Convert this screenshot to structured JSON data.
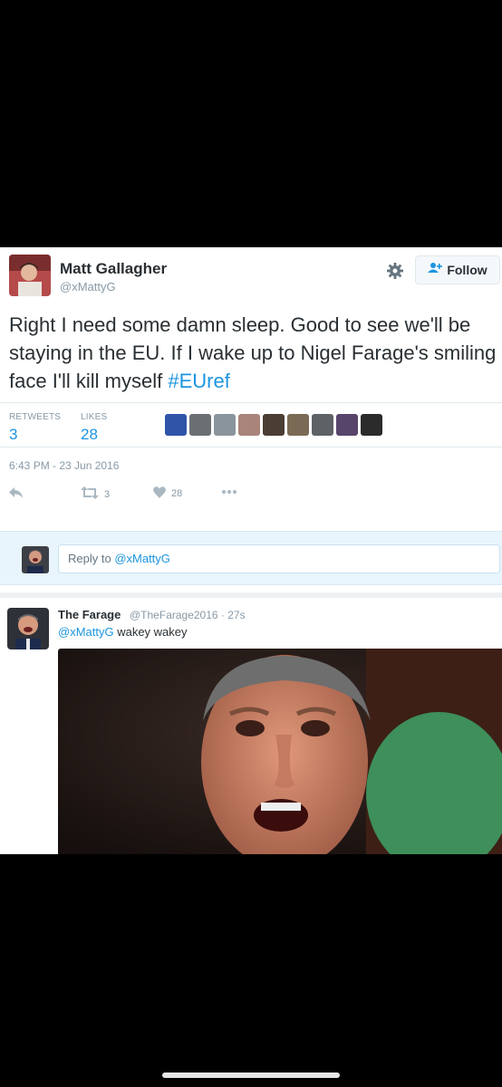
{
  "tweet": {
    "display_name": "Matt Gallagher",
    "handle": "@xMattyG",
    "follow_label": "Follow",
    "text_main": "Right I need some damn sleep. Good to see we'll be staying in the EU. If I wake up to Nigel Farage's smiling face I'll kill myself ",
    "hashtag": "#EUref",
    "retweets_label": "RETWEETS",
    "retweets_count": "3",
    "likes_label": "LIKES",
    "likes_count": "28",
    "timestamp": "6:43 PM - 23 Jun 2016",
    "action_retweet_count": "3",
    "action_like_count": "28"
  },
  "reply_box": {
    "text_prefix": "Reply to ",
    "mention": "@xMattyG"
  },
  "reply": {
    "display_name": "The Farage",
    "meta": "@TheFarage2016 · 27s",
    "mention": "@xMattyG",
    "text": " wakey wakey"
  },
  "colors": {
    "accent_blue": "#1b95e0",
    "text_dark": "#292f33",
    "text_muted": "#8899a6",
    "reply_bar_bg": "#e8f5fd"
  },
  "icons": [
    "gear-icon",
    "follow-person-icon",
    "reply-icon",
    "retweet-icon",
    "heart-icon",
    "more-icon"
  ]
}
